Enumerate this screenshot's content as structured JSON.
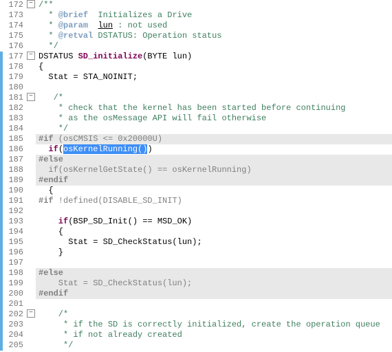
{
  "lines": [
    {
      "n": 172,
      "fold": "open",
      "mark": "",
      "hl": false,
      "tokens": [
        {
          "c": "tok-comment",
          "t": "/**"
        }
      ]
    },
    {
      "n": 173,
      "fold": "",
      "mark": "",
      "hl": false,
      "tokens": [
        {
          "c": "tok-comment",
          "t": "  * "
        },
        {
          "c": "tok-doctag",
          "t": "@brief"
        },
        {
          "c": "tok-comment",
          "t": "  Initializes a Drive"
        }
      ]
    },
    {
      "n": 174,
      "fold": "",
      "mark": "",
      "hl": false,
      "tokens": [
        {
          "c": "tok-comment",
          "t": "  * "
        },
        {
          "c": "tok-doctag",
          "t": "@param"
        },
        {
          "c": "tok-comment",
          "t": "  "
        },
        {
          "c": "tok-docvar",
          "t": "lun"
        },
        {
          "c": "tok-comment",
          "t": " : not used"
        }
      ]
    },
    {
      "n": 175,
      "fold": "",
      "mark": "",
      "hl": false,
      "tokens": [
        {
          "c": "tok-comment",
          "t": "  * "
        },
        {
          "c": "tok-doctag",
          "t": "@retval"
        },
        {
          "c": "tok-comment",
          "t": " DSTATUS: Operation status"
        }
      ]
    },
    {
      "n": 176,
      "fold": "",
      "mark": "",
      "hl": false,
      "tokens": [
        {
          "c": "tok-comment",
          "t": "  */"
        }
      ]
    },
    {
      "n": 177,
      "fold": "open",
      "mark": "blue",
      "hl": false,
      "tokens": [
        {
          "c": "tok-text",
          "t": "DSTATUS "
        },
        {
          "c": "tok-key",
          "t": "SD_initialize"
        },
        {
          "c": "tok-text",
          "t": "(BYTE lun)"
        }
      ]
    },
    {
      "n": 178,
      "fold": "",
      "mark": "blue",
      "hl": false,
      "tokens": [
        {
          "c": "tok-text",
          "t": "{"
        }
      ]
    },
    {
      "n": 179,
      "fold": "",
      "mark": "blue",
      "hl": false,
      "tokens": [
        {
          "c": "tok-text",
          "t": "  Stat = STA_NOINIT;"
        }
      ]
    },
    {
      "n": 180,
      "fold": "",
      "mark": "blue",
      "hl": false,
      "tokens": [
        {
          "c": "tok-text",
          "t": ""
        }
      ]
    },
    {
      "n": 181,
      "fold": "open",
      "mark": "blue",
      "hl": false,
      "tokens": [
        {
          "c": "tok-comment",
          "t": "   /*"
        }
      ]
    },
    {
      "n": 182,
      "fold": "",
      "mark": "blue",
      "hl": false,
      "tokens": [
        {
          "c": "tok-comment",
          "t": "    * check that the kernel has been started before continuing"
        }
      ]
    },
    {
      "n": 183,
      "fold": "",
      "mark": "blue",
      "hl": false,
      "tokens": [
        {
          "c": "tok-comment",
          "t": "    * as the osMessage API will fail otherwise"
        }
      ]
    },
    {
      "n": 184,
      "fold": "",
      "mark": "blue",
      "hl": false,
      "tokens": [
        {
          "c": "tok-comment",
          "t": "    */"
        }
      ]
    },
    {
      "n": 185,
      "fold": "",
      "mark": "blue",
      "hl": true,
      "tokens": [
        {
          "c": "tok-ppb",
          "t": "#if"
        },
        {
          "c": "tok-pp",
          "t": " (osCMSIS <= 0x20000U)"
        }
      ]
    },
    {
      "n": 186,
      "fold": "",
      "mark": "blue",
      "hl": false,
      "tokens": [
        {
          "c": "tok-key",
          "t": "  if"
        },
        {
          "c": "tok-text",
          "t": "("
        },
        {
          "c": "sel",
          "t": "osKernelRunning()"
        },
        {
          "c": "tok-text",
          "t": ")"
        }
      ]
    },
    {
      "n": 187,
      "fold": "",
      "mark": "blue",
      "hl": true,
      "tokens": [
        {
          "c": "tok-ppb",
          "t": "#else"
        }
      ]
    },
    {
      "n": 188,
      "fold": "",
      "mark": "blue",
      "hl": true,
      "tokens": [
        {
          "c": "dimmed",
          "t": "  if(osKernelGetState() == osKernelRunning)"
        }
      ]
    },
    {
      "n": 189,
      "fold": "",
      "mark": "blue",
      "hl": true,
      "tokens": [
        {
          "c": "tok-ppb",
          "t": "#endif"
        }
      ]
    },
    {
      "n": 190,
      "fold": "",
      "mark": "blue",
      "hl": false,
      "tokens": [
        {
          "c": "tok-text",
          "t": "  {"
        }
      ]
    },
    {
      "n": 191,
      "fold": "",
      "mark": "blue",
      "hl": false,
      "tokens": [
        {
          "c": "tok-ppb",
          "t": "#if"
        },
        {
          "c": "tok-pp",
          "t": " !defined(DISABLE_SD_INIT)"
        }
      ]
    },
    {
      "n": 192,
      "fold": "",
      "mark": "blue",
      "hl": false,
      "tokens": [
        {
          "c": "tok-text",
          "t": ""
        }
      ]
    },
    {
      "n": 193,
      "fold": "",
      "mark": "blue",
      "hl": false,
      "tokens": [
        {
          "c": "tok-key",
          "t": "    if"
        },
        {
          "c": "tok-text",
          "t": "(BSP_SD_Init() == MSD_OK)"
        }
      ]
    },
    {
      "n": 194,
      "fold": "",
      "mark": "blue",
      "hl": false,
      "tokens": [
        {
          "c": "tok-text",
          "t": "    {"
        }
      ]
    },
    {
      "n": 195,
      "fold": "",
      "mark": "blue",
      "hl": false,
      "tokens": [
        {
          "c": "tok-text",
          "t": "      Stat = SD_CheckStatus(lun);"
        }
      ]
    },
    {
      "n": 196,
      "fold": "",
      "mark": "blue",
      "hl": false,
      "tokens": [
        {
          "c": "tok-text",
          "t": "    }"
        }
      ]
    },
    {
      "n": 197,
      "fold": "",
      "mark": "blue",
      "hl": false,
      "tokens": [
        {
          "c": "tok-text",
          "t": ""
        }
      ]
    },
    {
      "n": 198,
      "fold": "",
      "mark": "blue",
      "hl": true,
      "tokens": [
        {
          "c": "tok-ppb",
          "t": "#else"
        }
      ]
    },
    {
      "n": 199,
      "fold": "",
      "mark": "blue",
      "hl": true,
      "tokens": [
        {
          "c": "dimmed",
          "t": "    Stat = SD_CheckStatus(lun);"
        }
      ]
    },
    {
      "n": 200,
      "fold": "",
      "mark": "blue",
      "hl": true,
      "tokens": [
        {
          "c": "tok-ppb",
          "t": "#endif"
        }
      ]
    },
    {
      "n": 201,
      "fold": "",
      "mark": "blue",
      "hl": false,
      "tokens": [
        {
          "c": "tok-text",
          "t": ""
        }
      ]
    },
    {
      "n": 202,
      "fold": "open",
      "mark": "blue",
      "hl": false,
      "tokens": [
        {
          "c": "tok-comment",
          "t": "    /*"
        }
      ]
    },
    {
      "n": 203,
      "fold": "",
      "mark": "blue",
      "hl": false,
      "tokens": [
        {
          "c": "tok-comment",
          "t": "     * if the SD is correctly initialized, create the operation queue"
        }
      ]
    },
    {
      "n": 204,
      "fold": "",
      "mark": "blue",
      "hl": false,
      "tokens": [
        {
          "c": "tok-comment",
          "t": "     * if not already created"
        }
      ]
    },
    {
      "n": 205,
      "fold": "",
      "mark": "blue",
      "hl": false,
      "tokens": [
        {
          "c": "tok-comment",
          "t": "     */"
        }
      ]
    }
  ]
}
